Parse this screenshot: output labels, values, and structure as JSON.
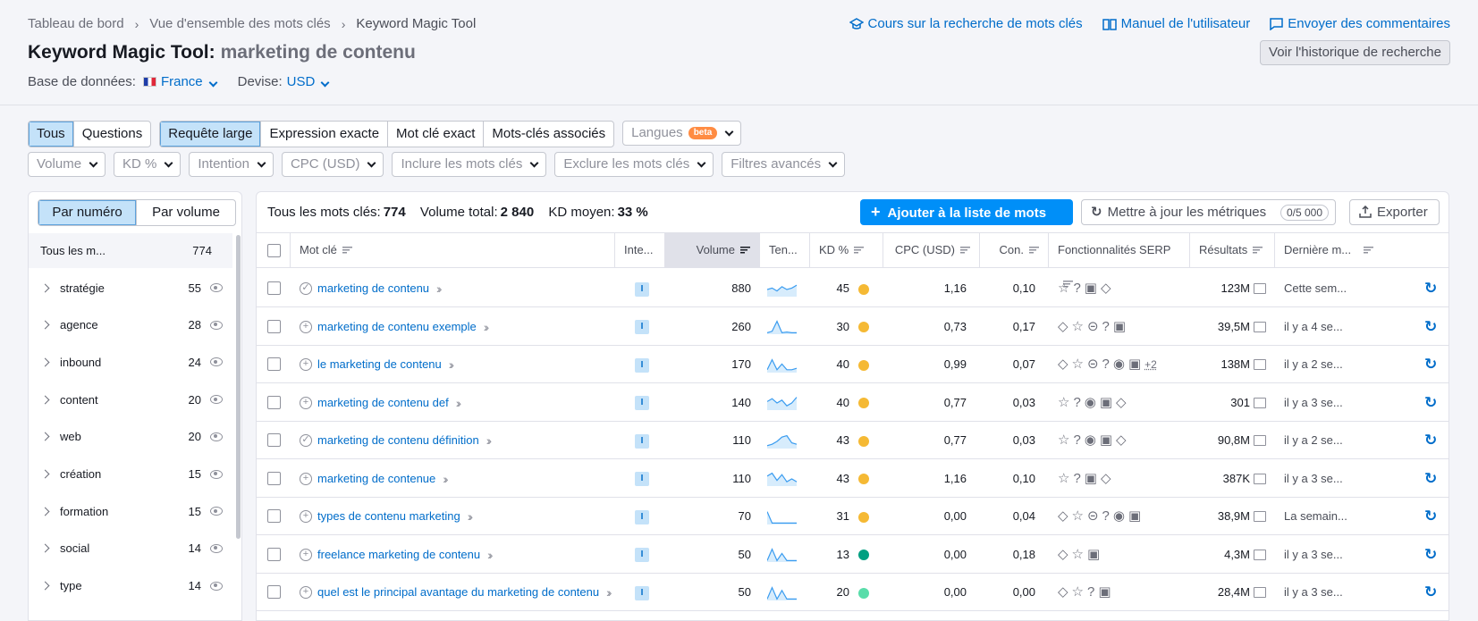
{
  "breadcrumb": [
    "Tableau de bord",
    "Vue d'ensemble des mots clés",
    "Keyword Magic Tool"
  ],
  "title": {
    "tool": "Keyword Magic Tool:",
    "query": "marketing de contenu"
  },
  "database": {
    "label": "Base de données:",
    "value": "France",
    "currency_label": "Devise:",
    "currency": "USD"
  },
  "top_links": [
    "Cours sur la recherche de mots clés",
    "Manuel de l'utilisateur",
    "Envoyer des commentaires"
  ],
  "history_button": "Voir l'historique de recherche",
  "filters": {
    "type_tabs": [
      "Tous",
      "Questions"
    ],
    "match_tabs": [
      "Requête large",
      "Expression exacte",
      "Mot clé exact",
      "Mots-clés associés"
    ],
    "languages": "Langues",
    "beta": "beta",
    "dropdowns": [
      "Volume",
      "KD %",
      "Intention",
      "CPC (USD)",
      "Inclure les mots clés",
      "Exclure les mots clés",
      "Filtres avancés"
    ]
  },
  "sidebar": {
    "tabs": [
      "Par numéro",
      "Par volume"
    ],
    "all_label": "Tous les m...",
    "all_count": "774",
    "groups": [
      {
        "name": "stratégie",
        "count": "55"
      },
      {
        "name": "agence",
        "count": "28"
      },
      {
        "name": "inbound",
        "count": "24"
      },
      {
        "name": "content",
        "count": "20"
      },
      {
        "name": "web",
        "count": "20"
      },
      {
        "name": "création",
        "count": "15"
      },
      {
        "name": "formation",
        "count": "15"
      },
      {
        "name": "social",
        "count": "14"
      },
      {
        "name": "type",
        "count": "14"
      }
    ]
  },
  "summary": {
    "all_label": "Tous les mots clés:",
    "all_value": "774",
    "volume_label": "Volume total:",
    "volume_value": "2 840",
    "kd_label": "KD moyen:",
    "kd_value": "33 %"
  },
  "actions": {
    "add": "Ajouter à la liste de mots clés",
    "update": "Mettre à jour les métriques",
    "update_count": "0/5 000",
    "export": "Exporter"
  },
  "columns": [
    "Mot clé",
    "Inte...",
    "Volume",
    "Ten...",
    "KD %",
    "CPC (USD)",
    "Con.",
    "Fonctionnalités SERP",
    "Résultats",
    "Dernière m..."
  ],
  "colors": {
    "kd_yellow": "#f5b934",
    "kd_green": "#009f81",
    "kd_lightgreen": "#59ddaa",
    "accent": "#008ff8"
  },
  "rows": [
    {
      "kw": "marketing de contenu",
      "icon": "check",
      "intent": "I",
      "volume": "880",
      "kd": "45",
      "kdc": "#f5b934",
      "cpc": "1,16",
      "com": "0,10",
      "serp": "☆?▣◇",
      "res": "123M",
      "upd": "Cette sem...",
      "trend": [
        0.5,
        0.6,
        0.4,
        0.7,
        0.5,
        0.6,
        0.8
      ]
    },
    {
      "kw": "marketing de contenu exemple",
      "icon": "plus",
      "intent": "I",
      "volume": "260",
      "kd": "30",
      "kdc": "#f5b934",
      "cpc": "0,73",
      "com": "0,17",
      "serp": "◇☆⊝?▣",
      "res": "39,5M",
      "upd": "il y a 4 se...",
      "trend": [
        0.1,
        0.2,
        0.9,
        0.1,
        0.15,
        0.1,
        0.1
      ]
    },
    {
      "kw": "le marketing de contenu",
      "icon": "plus",
      "intent": "I",
      "volume": "170",
      "kd": "40",
      "kdc": "#f5b934",
      "cpc": "0,99",
      "com": "0,07",
      "serp": "◇☆⊝?◉▣",
      "res": "138M",
      "upd": "il y a 2 se...",
      "trend": [
        0.2,
        0.9,
        0.2,
        0.6,
        0.2,
        0.2,
        0.3
      ],
      "more": "+2"
    },
    {
      "kw": "marketing de contenu def",
      "icon": "plus",
      "intent": "I",
      "volume": "140",
      "kd": "40",
      "kdc": "#f5b934",
      "cpc": "0,77",
      "com": "0,03",
      "serp": "☆?◉▣◇",
      "res": "301",
      "upd": "il y a 3 se...",
      "trend": [
        0.6,
        0.8,
        0.5,
        0.7,
        0.3,
        0.5,
        0.9
      ]
    },
    {
      "kw": "marketing de contenu définition",
      "icon": "check",
      "intent": "I",
      "volume": "110",
      "kd": "43",
      "kdc": "#f5b934",
      "cpc": "0,77",
      "com": "0,03",
      "serp": "☆?◉▣◇",
      "res": "90,8M",
      "upd": "il y a 2 se...",
      "trend": [
        0.2,
        0.3,
        0.5,
        0.8,
        0.9,
        0.4,
        0.3
      ]
    },
    {
      "kw": "marketing de contenue",
      "icon": "plus",
      "intent": "I",
      "volume": "110",
      "kd": "43",
      "kdc": "#f5b934",
      "cpc": "1,16",
      "com": "0,10",
      "serp": "☆?▣◇",
      "res": "387K",
      "upd": "il y a 3 se...",
      "trend": [
        0.7,
        0.9,
        0.4,
        0.8,
        0.3,
        0.5,
        0.3
      ]
    },
    {
      "kw": "types de contenu marketing",
      "icon": "plus",
      "intent": "I",
      "volume": "70",
      "kd": "31",
      "kdc": "#f5b934",
      "cpc": "0,00",
      "com": "0,04",
      "serp": "◇☆⊝?◉▣",
      "res": "38,9M",
      "upd": "La semain...",
      "trend": [
        0.9,
        0.1,
        0.1,
        0.1,
        0.1,
        0.1,
        0.1
      ]
    },
    {
      "kw": "freelance marketing de contenu",
      "icon": "plus",
      "intent": "I",
      "volume": "50",
      "kd": "13",
      "kdc": "#009f81",
      "cpc": "0,00",
      "com": "0,18",
      "serp": "◇☆▣",
      "res": "4,3M",
      "upd": "il y a 3 se...",
      "trend": [
        0.1,
        0.9,
        0.1,
        0.6,
        0.1,
        0.1,
        0.1
      ]
    },
    {
      "kw": "quel est le principal avantage du marketing de contenu",
      "icon": "plus",
      "intent": "I",
      "volume": "50",
      "kd": "20",
      "kdc": "#59ddaa",
      "cpc": "0,00",
      "com": "0,00",
      "serp": "◇☆?▣",
      "res": "28,4M",
      "upd": "il y a 3 se...",
      "trend": [
        0.1,
        0.9,
        0.1,
        0.7,
        0.1,
        0.1,
        0.1
      ]
    }
  ]
}
